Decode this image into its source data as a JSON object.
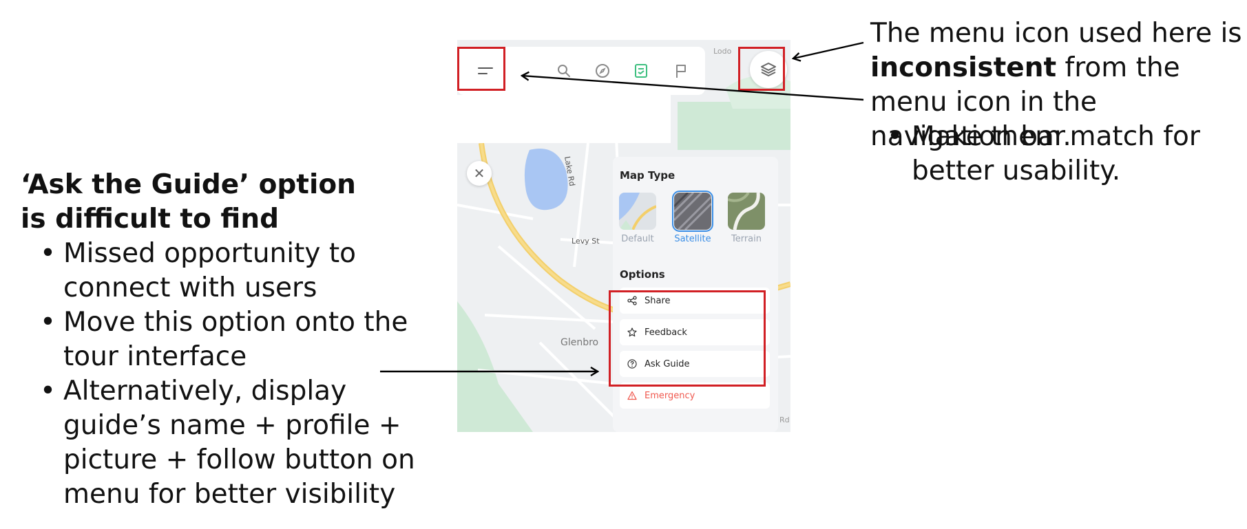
{
  "left_note": {
    "title": "‘Ask the Guide’ option is difficult to find",
    "bullets": [
      "Missed opportunity to connect with users",
      "Move this option onto the tour interface",
      "Alternatively, display guide’s name + profile + picture + follow button on menu for better visibility"
    ]
  },
  "right_note": {
    "text_before": "The menu icon used here is ",
    "text_bold": "inconsistent",
    "text_after": " from the menu icon in the navigation bar.",
    "bullets": [
      "Make them match for better usability."
    ]
  },
  "map": {
    "street_label": "Levy St",
    "road_label": "Lake Rd",
    "area_label": "Glenbro",
    "corner_label": "Lodo",
    "edge_label": "Rd"
  },
  "topbar_icons": [
    "menu-icon",
    "search-icon",
    "compass-icon",
    "list-icon",
    "flag-icon"
  ],
  "panel": {
    "map_type_heading": "Map Type",
    "map_types": [
      {
        "label": "Default",
        "selected": false
      },
      {
        "label": "Satellite",
        "selected": true
      },
      {
        "label": "Terrain",
        "selected": false
      }
    ],
    "options_heading": "Options",
    "options": [
      {
        "label": "Share",
        "icon": "share-icon"
      },
      {
        "label": "Feedback",
        "icon": "star-icon"
      },
      {
        "label": "Ask Guide",
        "icon": "question-circle-icon"
      },
      {
        "label": "Emergency",
        "icon": "warning-icon"
      }
    ]
  },
  "colors": {
    "highlight_red": "#d11f24",
    "selected_blue": "#3a8ee6",
    "emergency_red": "#f0584e",
    "green_icon": "#3dbf7f"
  }
}
